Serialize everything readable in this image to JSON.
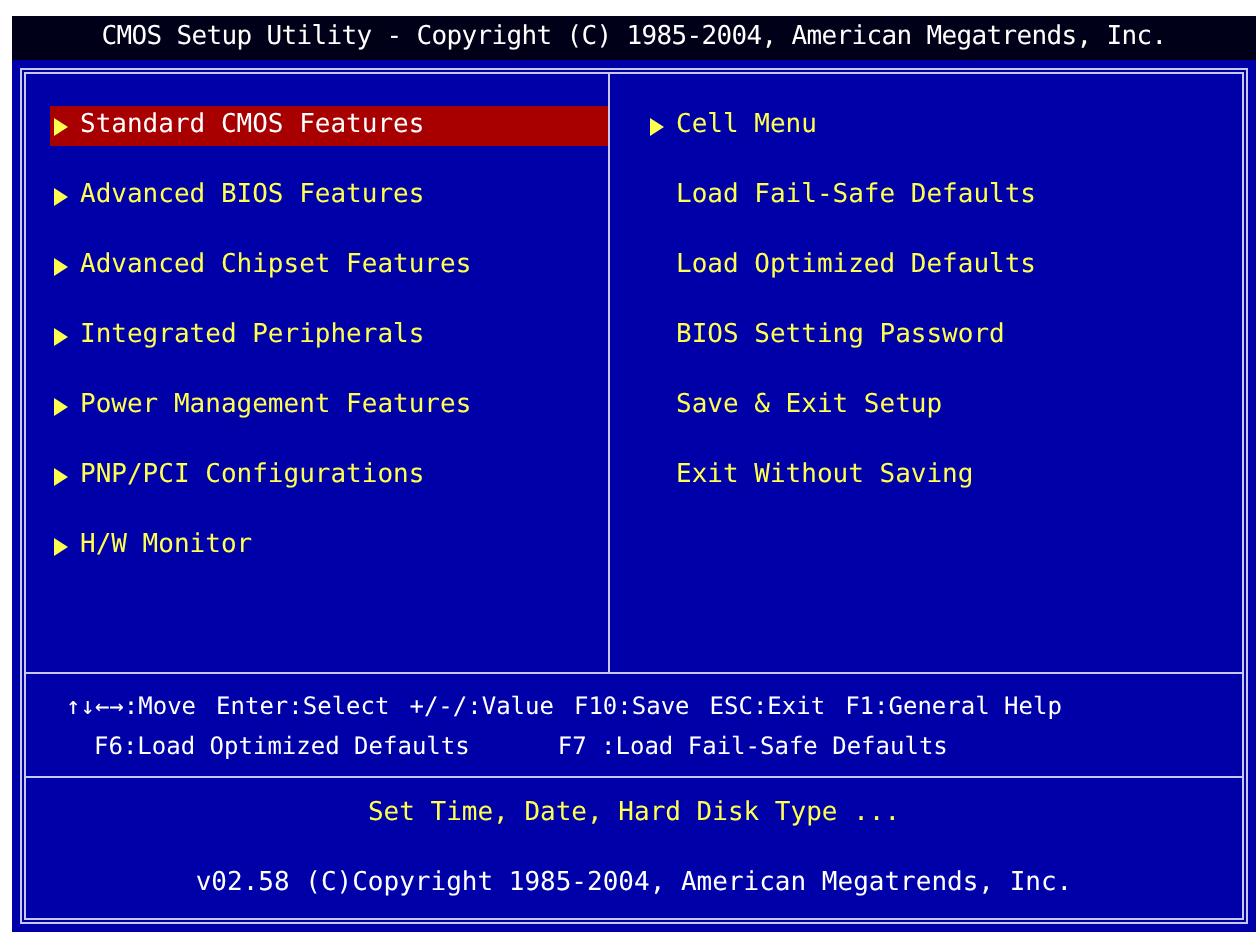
{
  "title_bar": {
    "title": "CMOS Setup Utility - Copyright (C) 1985-2004, American Megatrends, Inc."
  },
  "left_menu": [
    {
      "label": "Standard CMOS Features",
      "selected": true
    },
    {
      "label": "Advanced BIOS Features",
      "selected": false
    },
    {
      "label": "Advanced Chipset Features",
      "selected": false
    },
    {
      "label": "Integrated Peripherals",
      "selected": false
    },
    {
      "label": "Power Management Features",
      "selected": false
    },
    {
      "label": "PNP/PCI Configurations",
      "selected": false
    },
    {
      "label": "H/W Monitor",
      "selected": false
    }
  ],
  "right_menu": [
    {
      "label": "Cell Menu",
      "kind": "submenu",
      "selected": false
    },
    {
      "label": "Load Fail-Safe Defaults",
      "kind": "action",
      "selected": false
    },
    {
      "label": "Load Optimized Defaults",
      "kind": "action",
      "selected": false
    },
    {
      "label": "BIOS Setting Password",
      "kind": "action",
      "selected": false
    },
    {
      "label": "Save & Exit Setup",
      "kind": "action",
      "selected": false
    },
    {
      "label": "Exit Without Saving",
      "kind": "action",
      "selected": false
    }
  ],
  "key_help": [
    [
      "↑↓←→:Move",
      "Enter:Select",
      "+/-/:Value",
      "F10:Save",
      "ESC:Exit",
      "F1:General Help"
    ],
    [
      "F6:Load Optimized Defaults",
      "F7 :Load Fail-Safe Defaults"
    ]
  ],
  "description": "Set Time, Date, Hard Disk Type ...",
  "footer": "v02.58 (C)Copyright 1985-2004, American Megatrends, Inc."
}
